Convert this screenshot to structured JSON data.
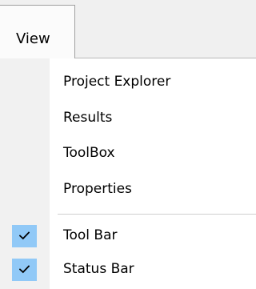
{
  "menubar": {
    "active_menu": "View"
  },
  "view_menu": {
    "items": [
      {
        "label": "Project Explorer",
        "checked": false
      },
      {
        "label": "Results",
        "checked": false
      },
      {
        "label": "ToolBox",
        "checked": false
      },
      {
        "label": "Properties",
        "checked": false
      }
    ],
    "toggles": [
      {
        "label": "Tool Bar",
        "checked": true,
        "icon": "checkmark-icon"
      },
      {
        "label": "Status Bar",
        "checked": true,
        "icon": "checkmark-icon"
      }
    ]
  },
  "colors": {
    "check_highlight": "#91c9f7",
    "gutter": "#f1f1f1",
    "menubar": "#f0f0f0"
  }
}
